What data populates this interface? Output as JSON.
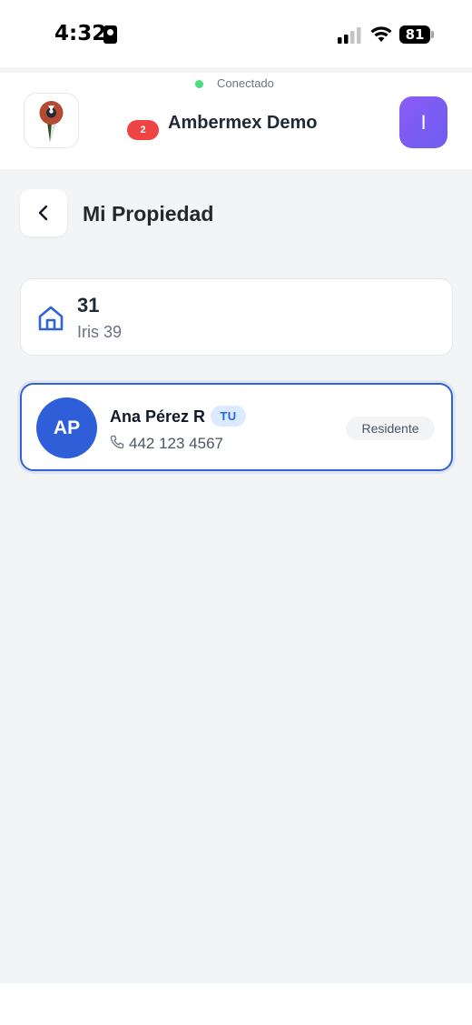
{
  "status_bar": {
    "time": "4:32",
    "battery": "81",
    "icons": [
      "id-card-icon",
      "signal-icon",
      "wifi-icon",
      "battery-icon"
    ]
  },
  "header": {
    "connection_status": "Conectado",
    "connection_color": "#4ade80",
    "notification_count": "2",
    "org_name": "Ambermex Demo",
    "user_initial": "I",
    "logo_icon": "map-pin-logo-icon"
  },
  "page": {
    "title": "Mi Propiedad",
    "back_icon": "chevron-left-icon"
  },
  "property": {
    "number": "31",
    "address": "Iris 39",
    "icon": "home-icon"
  },
  "resident": {
    "initials": "AP",
    "name": "Ana Pérez R",
    "you_badge": "TU",
    "phone": "442 123 4567",
    "role": "Residente",
    "phone_icon": "phone-icon"
  },
  "colors": {
    "accent": "#2f64d4",
    "badge": "#ef4444",
    "avatar_purple": "#7c5cf5",
    "background": "#f3f4f6"
  }
}
